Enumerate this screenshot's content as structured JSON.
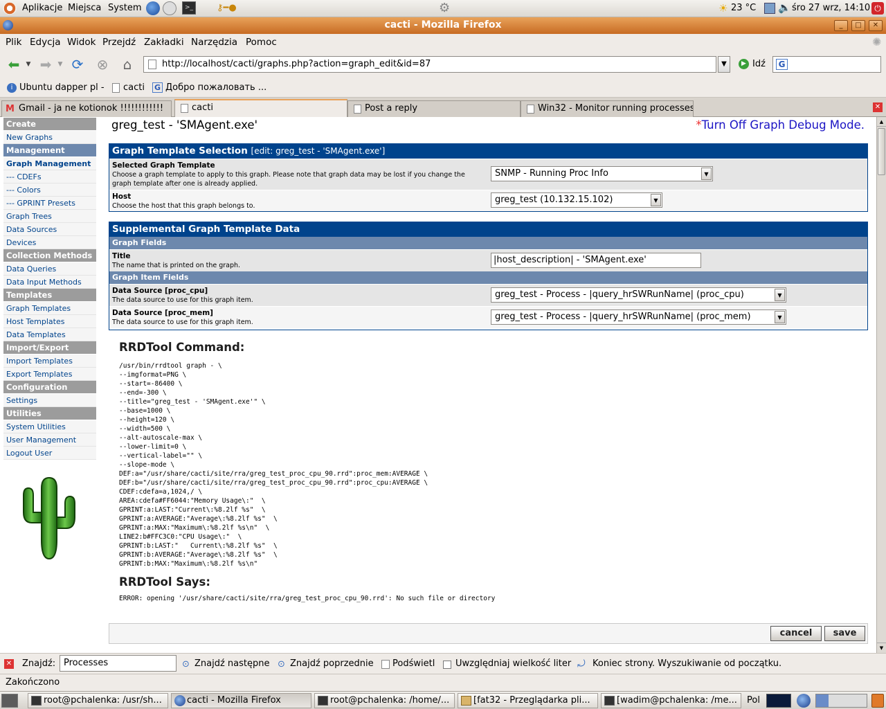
{
  "gnome_panel": {
    "menus": [
      "Aplikacje",
      "Miejsca",
      "System"
    ],
    "weather": "23 °C",
    "clock": "śro 27 wrz, 14:10"
  },
  "window": {
    "title": "cacti - Mozilla Firefox"
  },
  "menubar": {
    "items": [
      "Plik",
      "Edycja",
      "Widok",
      "Przejdź",
      "Zakładki",
      "Narzędzia",
      "Pomoc"
    ]
  },
  "navbar": {
    "url": "http://localhost/cacti/graphs.php?action=graph_edit&id=87",
    "go_label": "Idź"
  },
  "bookmarks": [
    "Ubuntu dapper pl -",
    "cacti",
    "Добро пожаловать ..."
  ],
  "tabs": [
    {
      "label": "Gmail - ja ne kotionok !!!!!!!!!!!!"
    },
    {
      "label": "cacti"
    },
    {
      "label": "Post a reply"
    },
    {
      "label": "Win32 - Monitor running processes"
    }
  ],
  "sidebar": {
    "items": [
      {
        "label": "Create",
        "type": "header"
      },
      {
        "label": "New Graphs",
        "type": "item"
      },
      {
        "label": "Management",
        "type": "header"
      },
      {
        "label": "Graph Management",
        "type": "current"
      },
      {
        "label": "--- CDEFs",
        "type": "item"
      },
      {
        "label": "--- Colors",
        "type": "item"
      },
      {
        "label": "--- GPRINT Presets",
        "type": "item"
      },
      {
        "label": "Graph Trees",
        "type": "item"
      },
      {
        "label": "Data Sources",
        "type": "item"
      },
      {
        "label": "Devices",
        "type": "item"
      },
      {
        "label": "Collection Methods",
        "type": "header"
      },
      {
        "label": "Data Queries",
        "type": "item"
      },
      {
        "label": "Data Input Methods",
        "type": "item"
      },
      {
        "label": "Templates",
        "type": "header"
      },
      {
        "label": "Graph Templates",
        "type": "item"
      },
      {
        "label": "Host Templates",
        "type": "item"
      },
      {
        "label": "Data Templates",
        "type": "item"
      },
      {
        "label": "Import/Export",
        "type": "header"
      },
      {
        "label": "Import Templates",
        "type": "item"
      },
      {
        "label": "Export Templates",
        "type": "item"
      },
      {
        "label": "Configuration",
        "type": "header"
      },
      {
        "label": "Settings",
        "type": "item"
      },
      {
        "label": "Utilities",
        "type": "header"
      },
      {
        "label": "System Utilities",
        "type": "item"
      },
      {
        "label": "User Management",
        "type": "item"
      },
      {
        "label": "Logout User",
        "type": "item"
      }
    ]
  },
  "main": {
    "page_title": "greg_test - 'SMAgent.exe'",
    "debug_asterisk": "*",
    "debug_link": "Turn Off Graph Debug Mode.",
    "template_panel": {
      "title": "Graph Template Selection",
      "subtitle": "[edit: greg_test - 'SMAgent.exe']",
      "selected_template_label": "Selected Graph Template",
      "selected_template_desc": "Choose a graph template to apply to this graph. Please note that graph data may be lost if you change the graph template after one is already applied.",
      "selected_template_value": "SNMP - Running Proc Info",
      "host_label": "Host",
      "host_desc": "Choose the host that this graph belongs to.",
      "host_value": "greg_test (10.132.15.102)"
    },
    "supp_panel": {
      "title": "Supplemental Graph Template Data",
      "graph_fields_label": "Graph Fields",
      "title_label": "Title",
      "title_desc": "The name that is printed on the graph.",
      "title_value": "|host_description| - 'SMAgent.exe'",
      "item_fields_label": "Graph Item Fields",
      "ds_cpu_label": "Data Source [proc_cpu]",
      "ds_cpu_desc": "The data source to use for this graph item.",
      "ds_cpu_value": "greg_test - Process - |query_hrSWRunName| (proc_cpu)",
      "ds_mem_label": "Data Source [proc_mem]",
      "ds_mem_desc": "The data source to use for this graph item.",
      "ds_mem_value": "greg_test - Process - |query_hrSWRunName| (proc_mem)"
    },
    "rrd": {
      "command_title": "RRDTool Command:",
      "command_lines": [
        "/usr/bin/rrdtool graph - \\",
        "--imgformat=PNG \\",
        "--start=-86400 \\",
        "--end=-300 \\",
        "--title=\"greg_test - 'SMAgent.exe'\" \\",
        "--base=1000 \\",
        "--height=120 \\",
        "--width=500 \\",
        "--alt-autoscale-max \\",
        "--lower-limit=0 \\",
        "--vertical-label=\"\" \\",
        "--slope-mode \\",
        "DEF:a=\"/usr/share/cacti/site/rra/greg_test_proc_cpu_90.rrd\":proc_mem:AVERAGE \\",
        "DEF:b=\"/usr/share/cacti/site/rra/greg_test_proc_cpu_90.rrd\":proc_cpu:AVERAGE \\",
        "CDEF:cdefa=a,1024,/ \\",
        "AREA:cdefa#FF6044:\"Memory Usage\\:\"  \\",
        "GPRINT:a:LAST:\"Current\\:%8.2lf %s\"  \\",
        "GPRINT:a:AVERAGE:\"Average\\:%8.2lf %s\"  \\",
        "GPRINT:a:MAX:\"Maximum\\:%8.2lf %s\\n\"  \\",
        "LINE2:b#FFC3C0:\"CPU Usage\\:\"  \\",
        "GPRINT:b:LAST:\"   Current\\:%8.2lf %s\"  \\",
        "GPRINT:b:AVERAGE:\"Average\\:%8.2lf %s\"  \\",
        "GPRINT:b:MAX:\"Maximum\\:%8.2lf %s\\n\""
      ],
      "says_title": "RRDTool Says:",
      "says_text": "ERROR: opening '/usr/share/cacti/site/rra/greg_test_proc_cpu_90.rrd': No such file or directory"
    },
    "buttons": {
      "cancel": "cancel",
      "save": "save"
    }
  },
  "findbar": {
    "label": "Znajdź:",
    "query": "Processes",
    "next": "Znajdź następne",
    "prev": "Znajdź poprzednie",
    "highlight": "Podświetl",
    "match_case": "Uwzględniaj wielkość liter",
    "message": "Koniec strony. Wyszukiwanie od początku."
  },
  "status": "Zakończono",
  "taskbar": {
    "tasks": [
      "root@pchalenka: /usr/sh...",
      "cacti - Mozilla Firefox",
      "root@pchalenka: /home/...",
      "[fat32 - Przeglądarka pli...",
      "[wadim@pchalenka: /me..."
    ],
    "keyboard": "Pol"
  },
  "colors": {
    "cacti_header": "#00438c",
    "cacti_subheader": "#6d88ad",
    "sidebar_header": "#9c9c9c",
    "titlebar": "#d98a3e",
    "debug_link": "#1b14c4"
  }
}
